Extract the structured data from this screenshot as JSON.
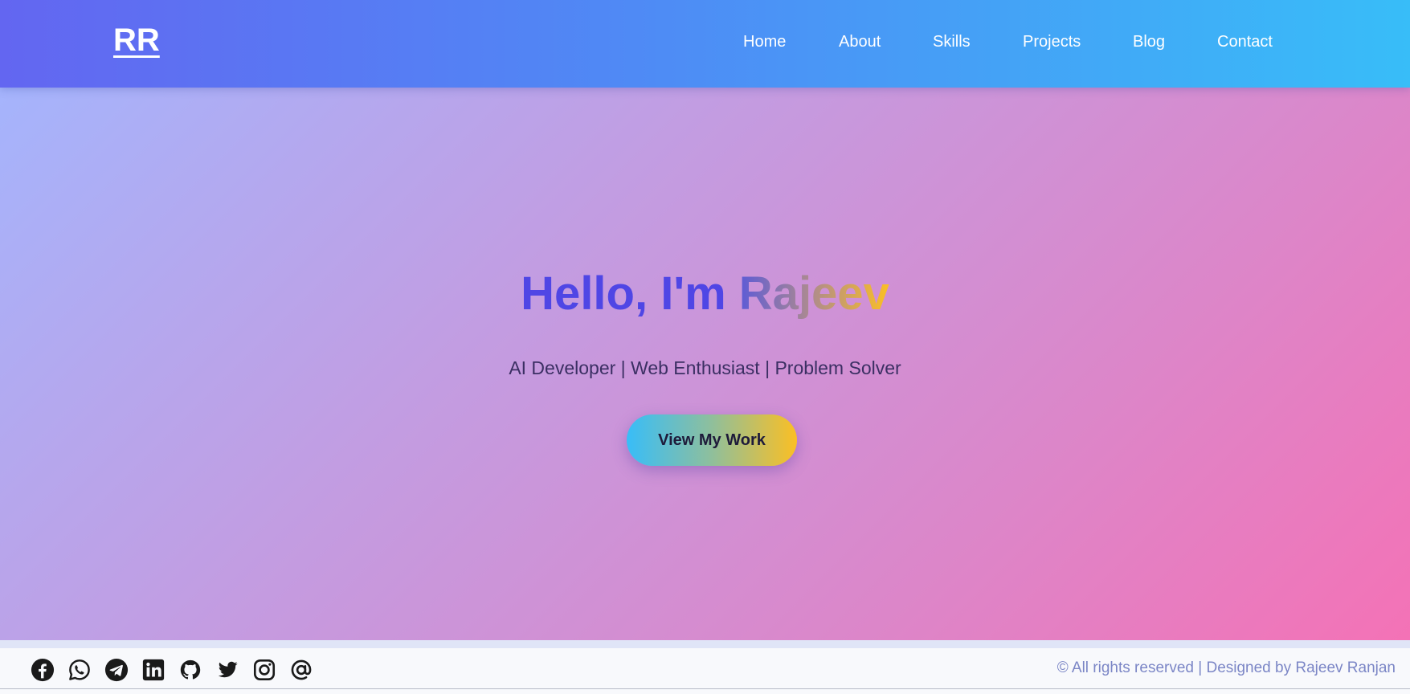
{
  "header": {
    "logo": "RR",
    "nav": [
      {
        "label": "Home"
      },
      {
        "label": "About"
      },
      {
        "label": "Skills"
      },
      {
        "label": "Projects"
      },
      {
        "label": "Blog"
      },
      {
        "label": "Contact"
      }
    ]
  },
  "hero": {
    "greeting": "Hello, I'm ",
    "name": "Rajeev",
    "subtitle": "AI Developer | Web Enthusiast | Problem Solver",
    "cta_label": "View My Work"
  },
  "footer": {
    "social_icons": [
      "facebook-icon",
      "whatsapp-icon",
      "telegram-icon",
      "linkedin-icon",
      "github-icon",
      "twitter-icon",
      "instagram-icon",
      "email-at-icon"
    ],
    "copyright": "© All rights reserved | Designed by Rajeev Ranjan"
  },
  "colors": {
    "header_gradient": [
      "#6366f1",
      "#38bdf8"
    ],
    "hero_gradient": [
      "#a5b4fc",
      "#f472b6"
    ],
    "accent_title": "#4f46e5",
    "cta_gradient": [
      "#38bdf8",
      "#fbbf24"
    ],
    "footer_text": "#7b86c6"
  }
}
